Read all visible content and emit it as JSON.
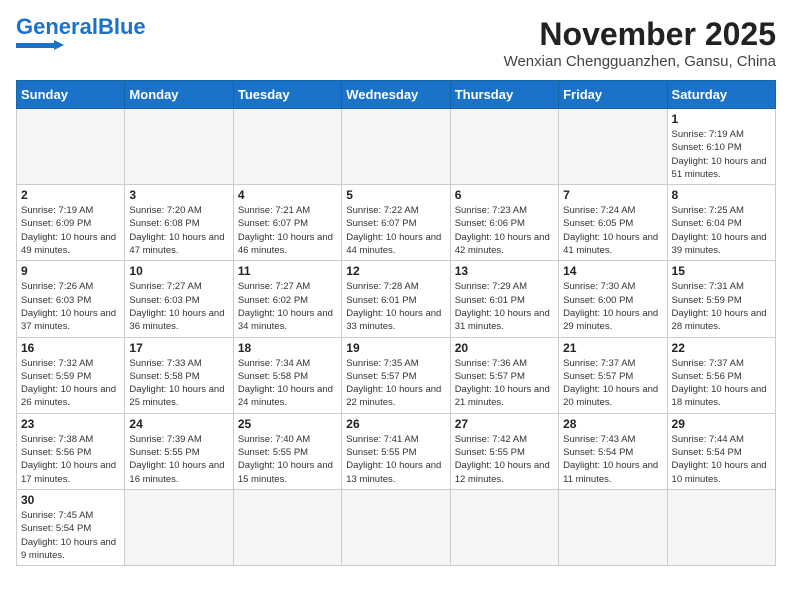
{
  "header": {
    "logo_general": "General",
    "logo_blue": "Blue",
    "month_title": "November 2025",
    "location": "Wenxian Chengguanzhen, Gansu, China"
  },
  "weekdays": [
    "Sunday",
    "Monday",
    "Tuesday",
    "Wednesday",
    "Thursday",
    "Friday",
    "Saturday"
  ],
  "weeks": [
    [
      {
        "day": "",
        "info": ""
      },
      {
        "day": "",
        "info": ""
      },
      {
        "day": "",
        "info": ""
      },
      {
        "day": "",
        "info": ""
      },
      {
        "day": "",
        "info": ""
      },
      {
        "day": "",
        "info": ""
      },
      {
        "day": "1",
        "info": "Sunrise: 7:19 AM\nSunset: 6:10 PM\nDaylight: 10 hours and 51 minutes."
      }
    ],
    [
      {
        "day": "2",
        "info": "Sunrise: 7:19 AM\nSunset: 6:09 PM\nDaylight: 10 hours and 49 minutes."
      },
      {
        "day": "3",
        "info": "Sunrise: 7:20 AM\nSunset: 6:08 PM\nDaylight: 10 hours and 47 minutes."
      },
      {
        "day": "4",
        "info": "Sunrise: 7:21 AM\nSunset: 6:07 PM\nDaylight: 10 hours and 46 minutes."
      },
      {
        "day": "5",
        "info": "Sunrise: 7:22 AM\nSunset: 6:07 PM\nDaylight: 10 hours and 44 minutes."
      },
      {
        "day": "6",
        "info": "Sunrise: 7:23 AM\nSunset: 6:06 PM\nDaylight: 10 hours and 42 minutes."
      },
      {
        "day": "7",
        "info": "Sunrise: 7:24 AM\nSunset: 6:05 PM\nDaylight: 10 hours and 41 minutes."
      },
      {
        "day": "8",
        "info": "Sunrise: 7:25 AM\nSunset: 6:04 PM\nDaylight: 10 hours and 39 minutes."
      }
    ],
    [
      {
        "day": "9",
        "info": "Sunrise: 7:26 AM\nSunset: 6:03 PM\nDaylight: 10 hours and 37 minutes."
      },
      {
        "day": "10",
        "info": "Sunrise: 7:27 AM\nSunset: 6:03 PM\nDaylight: 10 hours and 36 minutes."
      },
      {
        "day": "11",
        "info": "Sunrise: 7:27 AM\nSunset: 6:02 PM\nDaylight: 10 hours and 34 minutes."
      },
      {
        "day": "12",
        "info": "Sunrise: 7:28 AM\nSunset: 6:01 PM\nDaylight: 10 hours and 33 minutes."
      },
      {
        "day": "13",
        "info": "Sunrise: 7:29 AM\nSunset: 6:01 PM\nDaylight: 10 hours and 31 minutes."
      },
      {
        "day": "14",
        "info": "Sunrise: 7:30 AM\nSunset: 6:00 PM\nDaylight: 10 hours and 29 minutes."
      },
      {
        "day": "15",
        "info": "Sunrise: 7:31 AM\nSunset: 5:59 PM\nDaylight: 10 hours and 28 minutes."
      }
    ],
    [
      {
        "day": "16",
        "info": "Sunrise: 7:32 AM\nSunset: 5:59 PM\nDaylight: 10 hours and 26 minutes."
      },
      {
        "day": "17",
        "info": "Sunrise: 7:33 AM\nSunset: 5:58 PM\nDaylight: 10 hours and 25 minutes."
      },
      {
        "day": "18",
        "info": "Sunrise: 7:34 AM\nSunset: 5:58 PM\nDaylight: 10 hours and 24 minutes."
      },
      {
        "day": "19",
        "info": "Sunrise: 7:35 AM\nSunset: 5:57 PM\nDaylight: 10 hours and 22 minutes."
      },
      {
        "day": "20",
        "info": "Sunrise: 7:36 AM\nSunset: 5:57 PM\nDaylight: 10 hours and 21 minutes."
      },
      {
        "day": "21",
        "info": "Sunrise: 7:37 AM\nSunset: 5:57 PM\nDaylight: 10 hours and 20 minutes."
      },
      {
        "day": "22",
        "info": "Sunrise: 7:37 AM\nSunset: 5:56 PM\nDaylight: 10 hours and 18 minutes."
      }
    ],
    [
      {
        "day": "23",
        "info": "Sunrise: 7:38 AM\nSunset: 5:56 PM\nDaylight: 10 hours and 17 minutes."
      },
      {
        "day": "24",
        "info": "Sunrise: 7:39 AM\nSunset: 5:55 PM\nDaylight: 10 hours and 16 minutes."
      },
      {
        "day": "25",
        "info": "Sunrise: 7:40 AM\nSunset: 5:55 PM\nDaylight: 10 hours and 15 minutes."
      },
      {
        "day": "26",
        "info": "Sunrise: 7:41 AM\nSunset: 5:55 PM\nDaylight: 10 hours and 13 minutes."
      },
      {
        "day": "27",
        "info": "Sunrise: 7:42 AM\nSunset: 5:55 PM\nDaylight: 10 hours and 12 minutes."
      },
      {
        "day": "28",
        "info": "Sunrise: 7:43 AM\nSunset: 5:54 PM\nDaylight: 10 hours and 11 minutes."
      },
      {
        "day": "29",
        "info": "Sunrise: 7:44 AM\nSunset: 5:54 PM\nDaylight: 10 hours and 10 minutes."
      }
    ],
    [
      {
        "day": "30",
        "info": "Sunrise: 7:45 AM\nSunset: 5:54 PM\nDaylight: 10 hours and 9 minutes."
      },
      {
        "day": "",
        "info": ""
      },
      {
        "day": "",
        "info": ""
      },
      {
        "day": "",
        "info": ""
      },
      {
        "day": "",
        "info": ""
      },
      {
        "day": "",
        "info": ""
      },
      {
        "day": "",
        "info": ""
      }
    ]
  ]
}
